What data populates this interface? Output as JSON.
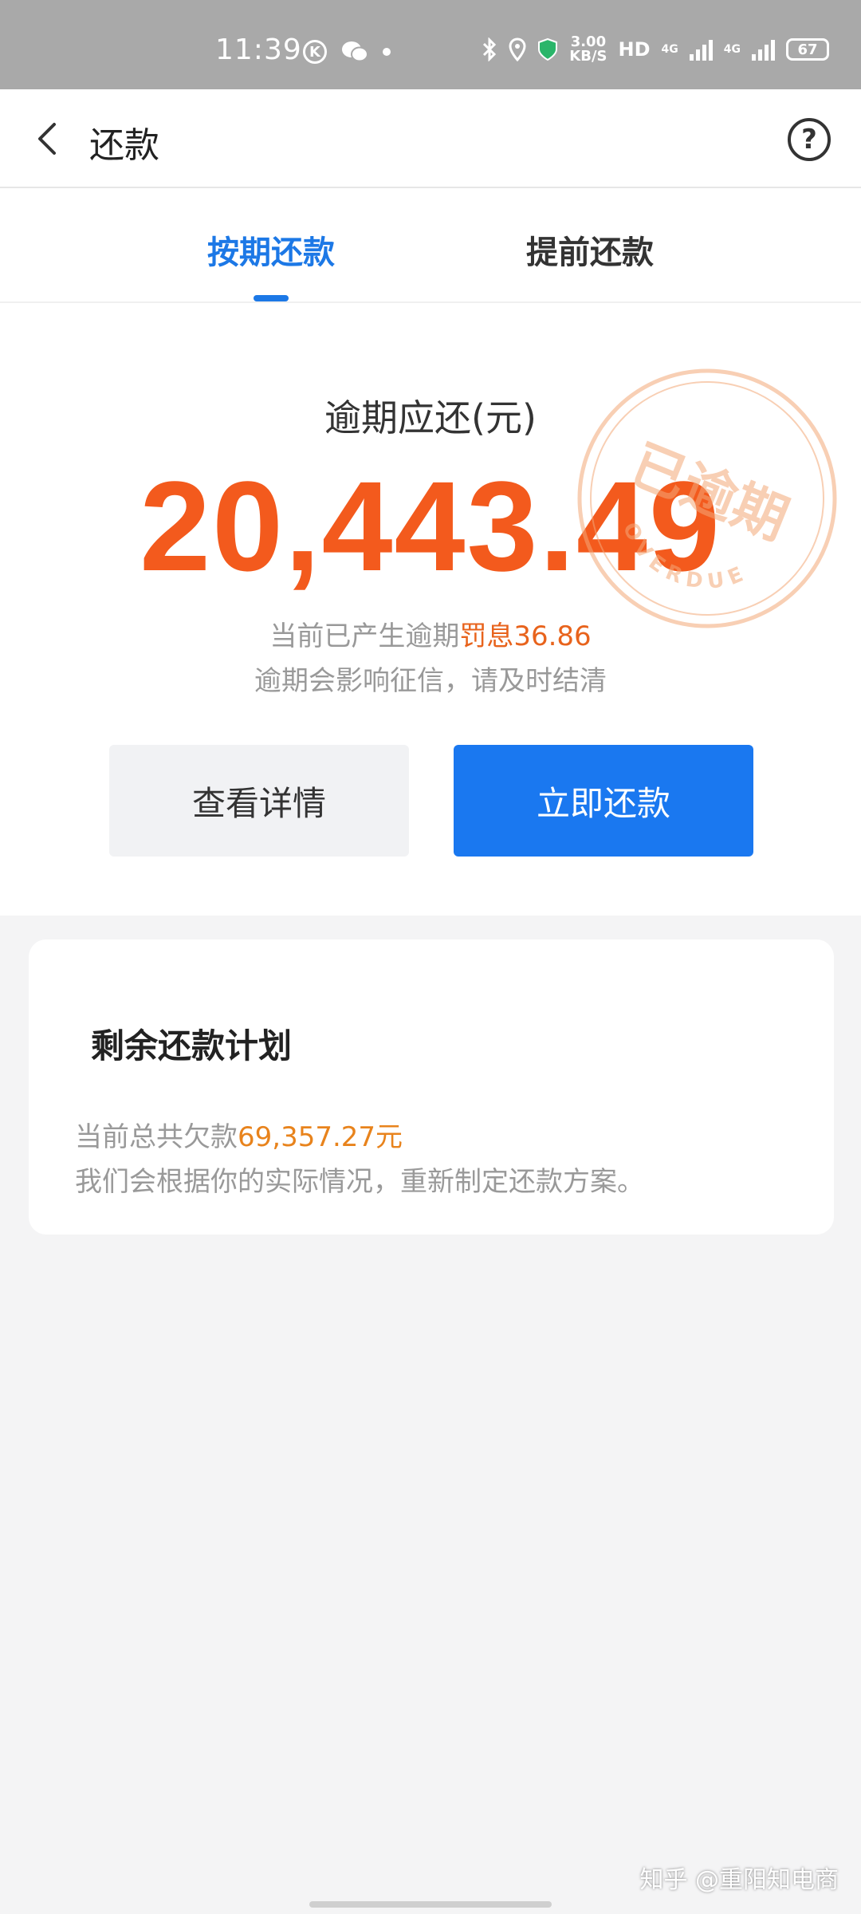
{
  "status_bar": {
    "time": "11:39",
    "speed_value": "3.00",
    "speed_unit": "KB/S",
    "hd": "HD",
    "net1": "4G",
    "net2": "4G",
    "battery": "67"
  },
  "header": {
    "title": "还款"
  },
  "tabs": [
    {
      "label": "按期还款",
      "active": true
    },
    {
      "label": "提前还款",
      "active": false
    }
  ],
  "overdue": {
    "label": "逾期应还(元)",
    "amount": "20,443.49",
    "penalty_prefix": "当前已产生逾期",
    "penalty_value": "罚息36.86",
    "warning": "逾期会影响征信，请及时结清",
    "stamp_text": "已逾期",
    "stamp_sub": "OVERDUE",
    "accent_color": "#f35a1d"
  },
  "buttons": {
    "detail_label": "查看详情",
    "pay_label": "立即还款",
    "pay_color": "#1a78f0"
  },
  "plan": {
    "title": "剩余还款计划",
    "debt_prefix": "当前总共欠款",
    "debt_value": "69,357.27元",
    "note": "我们会根据你的实际情况，重新制定还款方案。"
  },
  "watermark": "知乎 @重阳知电商"
}
